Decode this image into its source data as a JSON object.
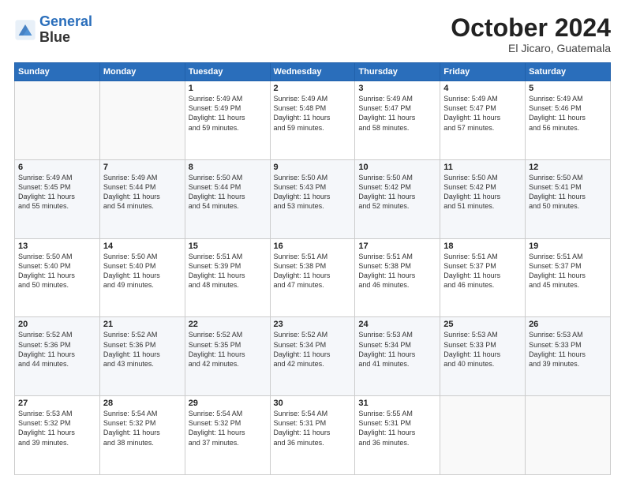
{
  "logo": {
    "line1": "General",
    "line2": "Blue"
  },
  "header": {
    "title": "October 2024",
    "subtitle": "El Jicaro, Guatemala"
  },
  "weekdays": [
    "Sunday",
    "Monday",
    "Tuesday",
    "Wednesday",
    "Thursday",
    "Friday",
    "Saturday"
  ],
  "weeks": [
    [
      {
        "day": "",
        "info": ""
      },
      {
        "day": "",
        "info": ""
      },
      {
        "day": "1",
        "info": "Sunrise: 5:49 AM\nSunset: 5:49 PM\nDaylight: 11 hours\nand 59 minutes."
      },
      {
        "day": "2",
        "info": "Sunrise: 5:49 AM\nSunset: 5:48 PM\nDaylight: 11 hours\nand 59 minutes."
      },
      {
        "day": "3",
        "info": "Sunrise: 5:49 AM\nSunset: 5:47 PM\nDaylight: 11 hours\nand 58 minutes."
      },
      {
        "day": "4",
        "info": "Sunrise: 5:49 AM\nSunset: 5:47 PM\nDaylight: 11 hours\nand 57 minutes."
      },
      {
        "day": "5",
        "info": "Sunrise: 5:49 AM\nSunset: 5:46 PM\nDaylight: 11 hours\nand 56 minutes."
      }
    ],
    [
      {
        "day": "6",
        "info": "Sunrise: 5:49 AM\nSunset: 5:45 PM\nDaylight: 11 hours\nand 55 minutes."
      },
      {
        "day": "7",
        "info": "Sunrise: 5:49 AM\nSunset: 5:44 PM\nDaylight: 11 hours\nand 54 minutes."
      },
      {
        "day": "8",
        "info": "Sunrise: 5:50 AM\nSunset: 5:44 PM\nDaylight: 11 hours\nand 54 minutes."
      },
      {
        "day": "9",
        "info": "Sunrise: 5:50 AM\nSunset: 5:43 PM\nDaylight: 11 hours\nand 53 minutes."
      },
      {
        "day": "10",
        "info": "Sunrise: 5:50 AM\nSunset: 5:42 PM\nDaylight: 11 hours\nand 52 minutes."
      },
      {
        "day": "11",
        "info": "Sunrise: 5:50 AM\nSunset: 5:42 PM\nDaylight: 11 hours\nand 51 minutes."
      },
      {
        "day": "12",
        "info": "Sunrise: 5:50 AM\nSunset: 5:41 PM\nDaylight: 11 hours\nand 50 minutes."
      }
    ],
    [
      {
        "day": "13",
        "info": "Sunrise: 5:50 AM\nSunset: 5:40 PM\nDaylight: 11 hours\nand 50 minutes."
      },
      {
        "day": "14",
        "info": "Sunrise: 5:50 AM\nSunset: 5:40 PM\nDaylight: 11 hours\nand 49 minutes."
      },
      {
        "day": "15",
        "info": "Sunrise: 5:51 AM\nSunset: 5:39 PM\nDaylight: 11 hours\nand 48 minutes."
      },
      {
        "day": "16",
        "info": "Sunrise: 5:51 AM\nSunset: 5:38 PM\nDaylight: 11 hours\nand 47 minutes."
      },
      {
        "day": "17",
        "info": "Sunrise: 5:51 AM\nSunset: 5:38 PM\nDaylight: 11 hours\nand 46 minutes."
      },
      {
        "day": "18",
        "info": "Sunrise: 5:51 AM\nSunset: 5:37 PM\nDaylight: 11 hours\nand 46 minutes."
      },
      {
        "day": "19",
        "info": "Sunrise: 5:51 AM\nSunset: 5:37 PM\nDaylight: 11 hours\nand 45 minutes."
      }
    ],
    [
      {
        "day": "20",
        "info": "Sunrise: 5:52 AM\nSunset: 5:36 PM\nDaylight: 11 hours\nand 44 minutes."
      },
      {
        "day": "21",
        "info": "Sunrise: 5:52 AM\nSunset: 5:36 PM\nDaylight: 11 hours\nand 43 minutes."
      },
      {
        "day": "22",
        "info": "Sunrise: 5:52 AM\nSunset: 5:35 PM\nDaylight: 11 hours\nand 42 minutes."
      },
      {
        "day": "23",
        "info": "Sunrise: 5:52 AM\nSunset: 5:34 PM\nDaylight: 11 hours\nand 42 minutes."
      },
      {
        "day": "24",
        "info": "Sunrise: 5:53 AM\nSunset: 5:34 PM\nDaylight: 11 hours\nand 41 minutes."
      },
      {
        "day": "25",
        "info": "Sunrise: 5:53 AM\nSunset: 5:33 PM\nDaylight: 11 hours\nand 40 minutes."
      },
      {
        "day": "26",
        "info": "Sunrise: 5:53 AM\nSunset: 5:33 PM\nDaylight: 11 hours\nand 39 minutes."
      }
    ],
    [
      {
        "day": "27",
        "info": "Sunrise: 5:53 AM\nSunset: 5:32 PM\nDaylight: 11 hours\nand 39 minutes."
      },
      {
        "day": "28",
        "info": "Sunrise: 5:54 AM\nSunset: 5:32 PM\nDaylight: 11 hours\nand 38 minutes."
      },
      {
        "day": "29",
        "info": "Sunrise: 5:54 AM\nSunset: 5:32 PM\nDaylight: 11 hours\nand 37 minutes."
      },
      {
        "day": "30",
        "info": "Sunrise: 5:54 AM\nSunset: 5:31 PM\nDaylight: 11 hours\nand 36 minutes."
      },
      {
        "day": "31",
        "info": "Sunrise: 5:55 AM\nSunset: 5:31 PM\nDaylight: 11 hours\nand 36 minutes."
      },
      {
        "day": "",
        "info": ""
      },
      {
        "day": "",
        "info": ""
      }
    ]
  ]
}
